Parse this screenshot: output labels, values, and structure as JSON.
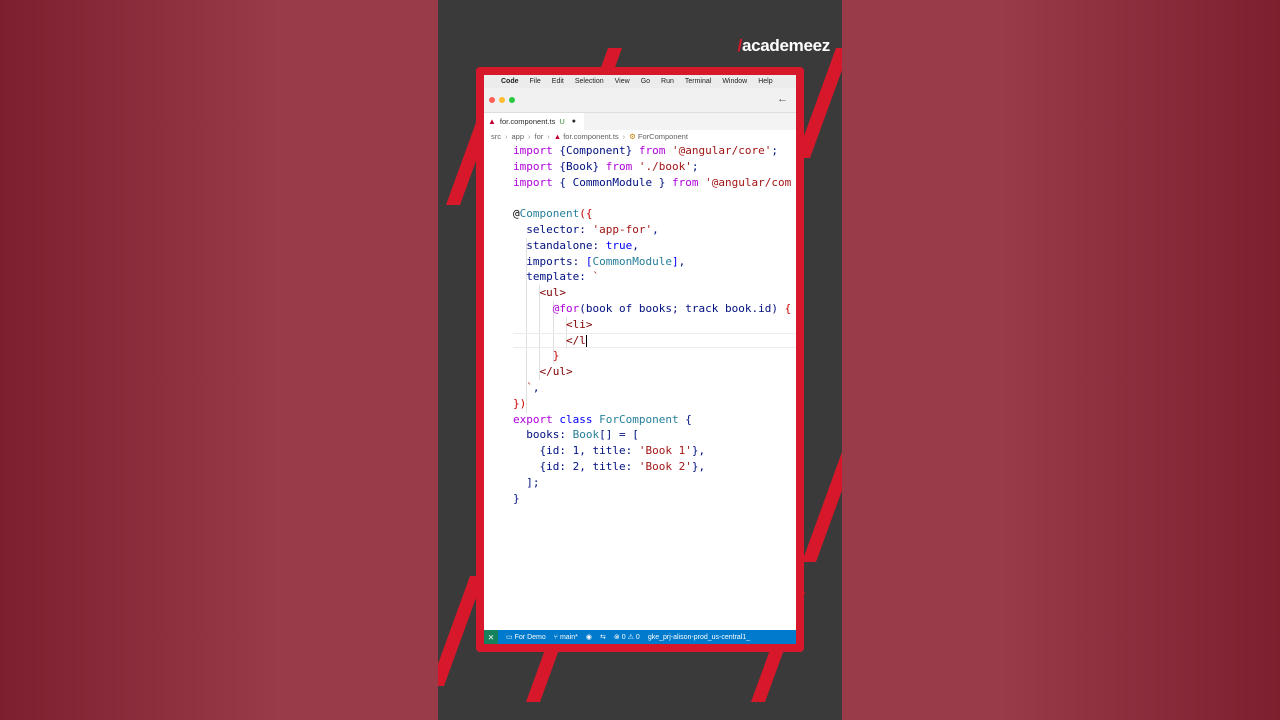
{
  "brand": {
    "logo_slash": "/",
    "logo_text": "academeez"
  },
  "menubar": {
    "apple": "",
    "app_name": "Code",
    "items": [
      "File",
      "Edit",
      "Selection",
      "View",
      "Go",
      "Run",
      "Terminal",
      "Window",
      "Help"
    ]
  },
  "titlebar": {
    "back": "←"
  },
  "tab": {
    "filename": "for.component.ts",
    "status": "U",
    "dirty": "●"
  },
  "breadcrumb": {
    "items": [
      "src",
      "app",
      "for",
      "for.component.ts",
      "ForComponent"
    ]
  },
  "statusbar": {
    "remote": "⨯",
    "project": "For Demo",
    "branch": "main*",
    "errors": "0",
    "warnings": "0",
    "cluster": "gke_prj-alison-prod_us-central1_"
  },
  "colors": {
    "accent_red": "#d7182a",
    "status_blue": "#007acc"
  }
}
